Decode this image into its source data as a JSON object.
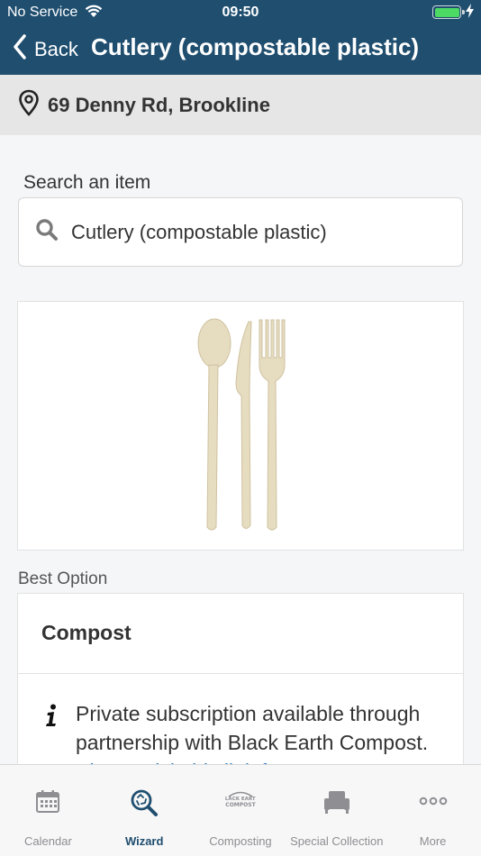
{
  "status_bar": {
    "carrier": "No Service",
    "time": "09:50"
  },
  "nav": {
    "back_label": "Back",
    "title": "Cutlery (compostable plastic)"
  },
  "address": {
    "text": "69 Denny Rd, Brookline"
  },
  "search": {
    "label": "Search an item",
    "value": "Cutlery (compostable plastic)"
  },
  "best_option": {
    "section_label": "Best Option",
    "title": "Compost",
    "description": "Private subscription available through partnership with Black Earth Compost. ",
    "link_text": "Please visit this link for"
  },
  "tabs": [
    {
      "label": "Calendar",
      "icon": "calendar-icon",
      "active": false
    },
    {
      "label": "Wizard",
      "icon": "wizard-search-icon",
      "active": true
    },
    {
      "label": "Composting",
      "icon": "black-earth-compost-logo",
      "active": false
    },
    {
      "label": "Special Collection",
      "icon": "armchair-icon",
      "active": false
    },
    {
      "label": "More",
      "icon": "more-dots-icon",
      "active": false
    }
  ],
  "colors": {
    "header": "#1f4e6f",
    "active_tab": "#1f4e6f",
    "link": "#2a7bbf",
    "battery": "#4cd964"
  }
}
